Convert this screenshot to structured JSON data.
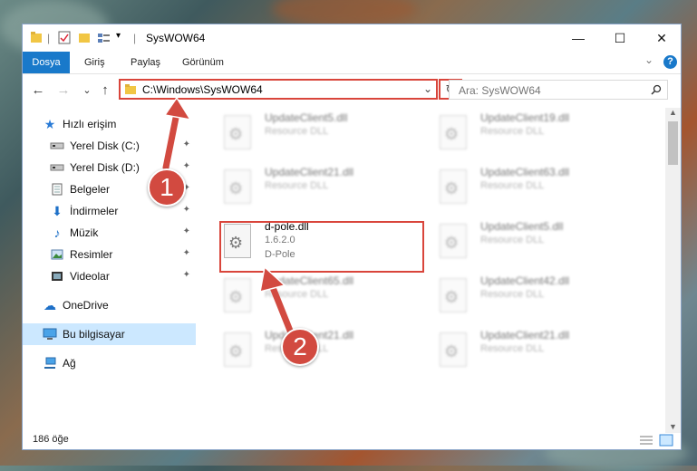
{
  "window": {
    "title": "SysWOW64",
    "controls": {
      "minimize": "—",
      "maximize": "☐",
      "close": "✕"
    }
  },
  "ribbon": {
    "tabs": [
      "Dosya",
      "Giriş",
      "Paylaş",
      "Görünüm"
    ],
    "help": "?",
    "expand": "⌄"
  },
  "navigation": {
    "back": "←",
    "forward": "→",
    "recent": "⌄",
    "up": "↑",
    "address": "C:\\Windows\\SysWOW64",
    "search_placeholder": "Ara: SysWOW64",
    "dropdown": "⌄",
    "refresh": "↻"
  },
  "sidebar": {
    "items": [
      {
        "label": "Hızlı erişim",
        "icon": "star-icon",
        "pinned": false
      },
      {
        "label": "Yerel Disk (C:)",
        "icon": "drive-icon",
        "pinned": true
      },
      {
        "label": "Yerel Disk (D:)",
        "icon": "drive-icon",
        "pinned": true
      },
      {
        "label": "Belgeler",
        "icon": "documents-icon",
        "pinned": true
      },
      {
        "label": "İndirmeler",
        "icon": "download-icon",
        "pinned": true
      },
      {
        "label": "Müzik",
        "icon": "music-icon",
        "pinned": true
      },
      {
        "label": "Resimler",
        "icon": "pictures-icon",
        "pinned": true
      },
      {
        "label": "Videolar",
        "icon": "video-icon",
        "pinned": true
      },
      {
        "label": "OneDrive",
        "icon": "cloud-icon",
        "pinned": false
      },
      {
        "label": "Bu bilgisayar",
        "icon": "computer-icon",
        "pinned": false,
        "selected": true
      },
      {
        "label": "Ağ",
        "icon": "network-icon",
        "pinned": false
      }
    ],
    "pin_glyph": "📌"
  },
  "files": [
    {
      "name": "UpdateClient5.dll",
      "sub": "Resource DLL"
    },
    {
      "name": "UpdateClient19.dll",
      "sub": "Resource DLL"
    },
    {
      "name": "UpdateClient21.dll",
      "sub": "Resource DLL"
    },
    {
      "name": "UpdateClient63.dll",
      "sub": "Resource DLL"
    },
    {
      "name": "d-pole.dll",
      "version": "1.6.2.0",
      "sub": "D-Pole",
      "highlighted": true
    },
    {
      "name": "UpdateClient5.dll",
      "sub": "Resource DLL"
    },
    {
      "name": "UpdateClient65.dll",
      "sub": "Resource DLL"
    },
    {
      "name": "UpdateClient42.dll",
      "sub": "Resource DLL"
    },
    {
      "name": "UpdateClient21.dll",
      "sub": "Resource DLL"
    },
    {
      "name": "UpdateClient21.dll",
      "sub": "Resource DLL"
    }
  ],
  "status": {
    "item_count": "186 öğe"
  },
  "annotations": {
    "badge1": "1",
    "badge2": "2",
    "color": "#d24a40"
  },
  "colors": {
    "accent": "#1979ca",
    "highlight": "#d9453b",
    "selected_bg": "#cce8ff"
  }
}
